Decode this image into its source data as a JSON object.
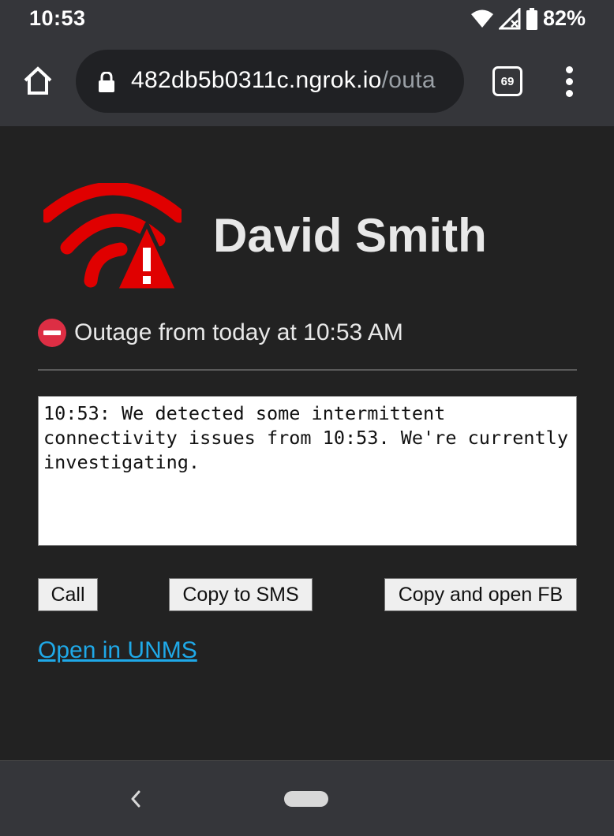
{
  "status_bar": {
    "time": "10:53",
    "battery": "82%",
    "icons": [
      "wifi-icon",
      "signal-icon",
      "battery-icon"
    ]
  },
  "browser": {
    "url_main": "482db5b0311c.ngrok.io",
    "url_rest": "/outa",
    "tab_count": "69"
  },
  "page": {
    "customer_name": "David Smith",
    "outage_text": "Outage from today at 10:53 AM",
    "message": "10:53: We detected some intermittent connectivity issues from 10:53. We're currently investigating.",
    "buttons": {
      "call": "Call",
      "sms": "Copy to SMS",
      "fb": "Copy and open FB"
    },
    "link": "Open in UNMS"
  },
  "colors": {
    "background": "#222222",
    "chrome": "#35363a",
    "logo_red": "#e00000",
    "link_blue": "#1fa9e8",
    "no_entry_red": "#dd2e44"
  }
}
